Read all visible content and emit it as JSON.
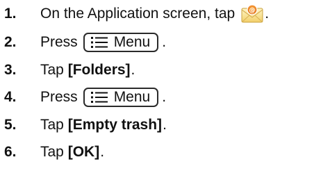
{
  "steps": [
    {
      "number": "1.",
      "text": "On the Application screen, tap",
      "end": "."
    },
    {
      "number": "2.",
      "text": "Press",
      "key": "Menu",
      "end": "."
    },
    {
      "number": "3.",
      "text": "Tap",
      "bold": "[Folders]",
      "end": "."
    },
    {
      "number": "4.",
      "text": "Press",
      "key": "Menu",
      "end": "."
    },
    {
      "number": "5.",
      "text": "Tap",
      "bold": "[Empty trash]",
      "end": "."
    },
    {
      "number": "6.",
      "text": "Tap",
      "bold": "[OK]",
      "end": "."
    }
  ],
  "icons": {
    "email_app": "email-app-icon",
    "menu": "menu-icon"
  }
}
